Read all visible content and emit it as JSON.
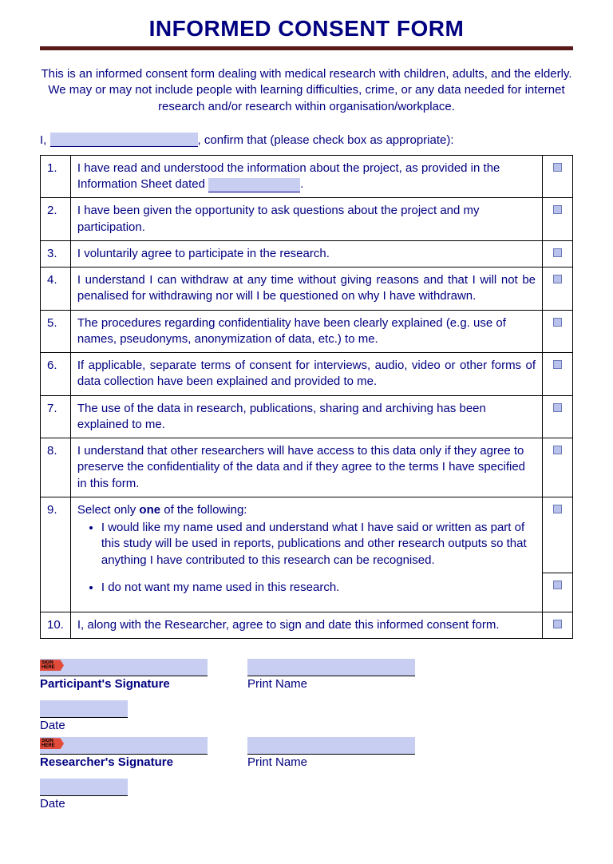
{
  "title": "INFORMED CONSENT FORM",
  "intro": "This is an informed consent form dealing with medical research with children, adults, and the elderly. We may or may not include people with learning difficulties, crime, or any data needed for internet research and/or research within organisation/workplace.",
  "confirm_prefix": "I, ",
  "confirm_suffix": ", confirm that (please check box as appropriate):",
  "items": [
    {
      "n": "1.",
      "text_pre": "I have read and understood the information about the project, as provided in the Information Sheet dated ",
      "text_post": "."
    },
    {
      "n": "2.",
      "text": "I have been given the opportunity to ask questions about the project and my participation."
    },
    {
      "n": "3.",
      "text": "I voluntarily agree to participate in the research."
    },
    {
      "n": "4.",
      "text": "I understand I can withdraw at any time without giving reasons and that I will not be penalised for withdrawing nor will I be questioned on why I have withdrawn.",
      "justify": true
    },
    {
      "n": "5.",
      "text": "The procedures regarding confidentiality have been clearly explained (e.g. use of names, pseudonyms, anonymization of data, etc.) to me."
    },
    {
      "n": "6.",
      "text": "If applicable, separate terms of consent for interviews, audio, video or other forms of data collection have been explained and provided to me.",
      "justify": true
    },
    {
      "n": "7.",
      "text": "The use of the data in research, publications, sharing and archiving has been explained to me."
    },
    {
      "n": "8.",
      "text": "I understand that other researchers will have access to this data only if they agree to preserve the confidentiality of the data and if they agree to the terms I have specified in this form."
    },
    {
      "n": "9.",
      "lead": "Select only ",
      "lead_bold": "one",
      "lead_after": " of the following:",
      "bullet1": "I would like my name used and understand what I have said or written as part of this study will be used in reports, publications and other research outputs so that anything I have contributed to this research can be recognised.",
      "bullet2": "I do not want my name used in this research."
    },
    {
      "n": "10.",
      "text": "I, along with the Researcher, agree to sign and date this informed consent form."
    }
  ],
  "sign_tag": "SIGN HERE",
  "labels": {
    "participant_sig": "Participant's Signature",
    "print_name": "Print Name",
    "date": "Date",
    "researcher_sig": "Researcher's Signature"
  }
}
